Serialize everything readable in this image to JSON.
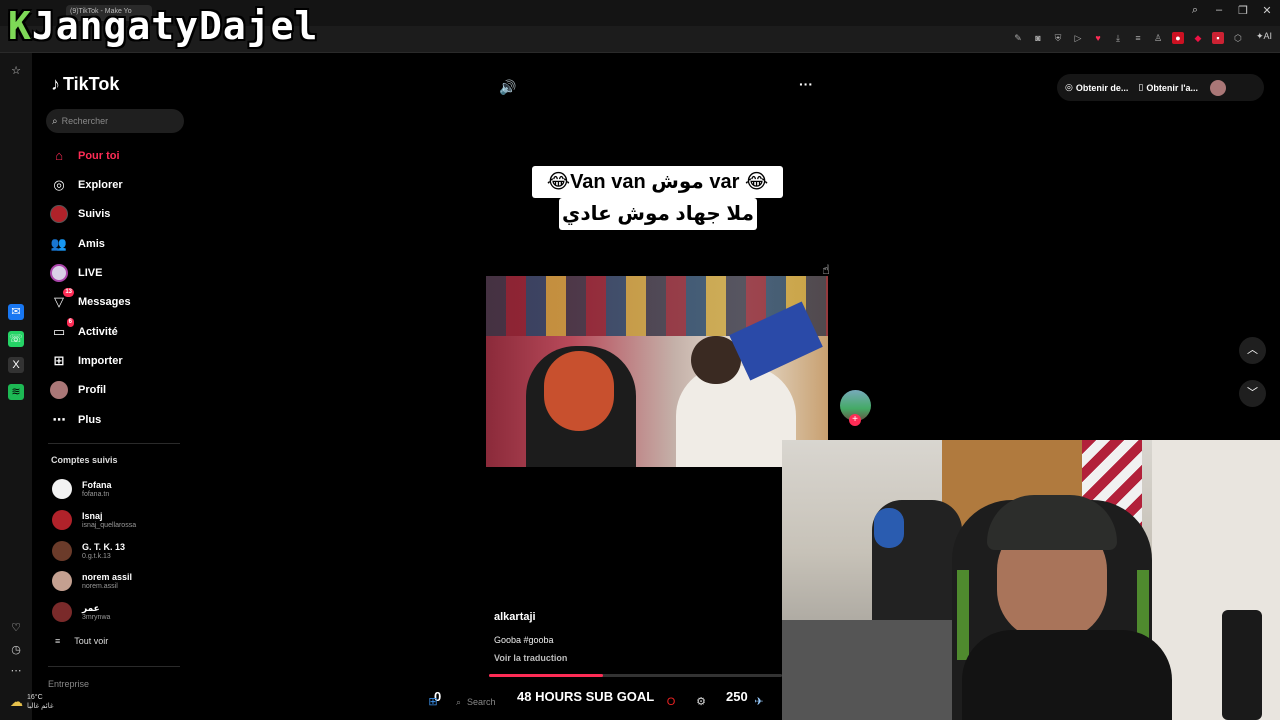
{
  "overlay": {
    "title_first": "K",
    "title_rest": "JangatyDajel"
  },
  "browser": {
    "tab_title": "(9)TikTok - Make Yo",
    "ai_label": "AI"
  },
  "tiktok": {
    "logo": "TikTok",
    "search_placeholder": "Rechercher",
    "nav": [
      {
        "label": "Pour toi",
        "icon": "home-icon"
      },
      {
        "label": "Explorer",
        "icon": "compass-icon"
      },
      {
        "label": "Suivis",
        "icon": "following-avatar"
      },
      {
        "label": "Amis",
        "icon": "friends-icon"
      },
      {
        "label": "LIVE",
        "icon": "live-icon"
      },
      {
        "label": "Messages",
        "icon": "messages-icon",
        "badge": "13"
      },
      {
        "label": "Activité",
        "icon": "activity-icon",
        "badge": "6"
      },
      {
        "label": "Importer",
        "icon": "upload-icon"
      },
      {
        "label": "Profil",
        "icon": "profile-avatar"
      },
      {
        "label": "Plus",
        "icon": "more-icon"
      }
    ],
    "following_title": "Comptes suivis",
    "following": [
      {
        "name": "Fofana",
        "handle": "fofana.tn",
        "color": "#f2f2f2"
      },
      {
        "name": "Isnaj",
        "handle": "isnaj_quellarossa",
        "color": "#b0222a"
      },
      {
        "name": "G. T. K. 13",
        "handle": "0.g.t.k.13",
        "color": "#6b3b2a"
      },
      {
        "name": "norem assil",
        "handle": "norem.assil",
        "color": "#c4a090"
      },
      {
        "name": "عمر",
        "handle": "3mrynwa",
        "color": "#7a2a2a"
      }
    ],
    "see_all": "Tout voir",
    "entreprise": "Entreprise"
  },
  "video": {
    "caption_line1": "😂Van van موش var 😂",
    "caption_line2": "ملا جهاد موش عادي",
    "username": "alkartaji",
    "description": "Gooba #gooba",
    "translate": "Voir la traduction",
    "progress": 0.39
  },
  "topright": {
    "btn1": "Obtenir de...",
    "btn2": "Obtenir l'a..."
  },
  "taskbar": {
    "temp": "16°C",
    "weather_sub": "غائم غالبا",
    "search": "Search",
    "goal": "48 HOURS SUB GOAL",
    "goal_current": "0",
    "goal_target": "250"
  },
  "colors": {
    "accent": "#fe2c55",
    "logo_green": "#7ed957"
  }
}
